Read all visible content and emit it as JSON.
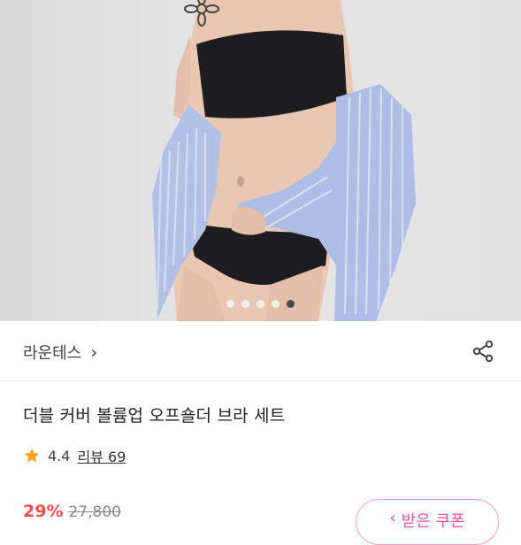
{
  "product": {
    "brand": "라운테스",
    "title": "더블 커버 볼륨업 오프숄더 브라 세트",
    "rating": "4.4",
    "review_label": "리뷰 69",
    "discount": "29%",
    "original_price": "27,800",
    "coupon_label": "받은 쿠폰"
  },
  "gallery": {
    "slide_count": 5,
    "active_index": 4
  },
  "icons": {
    "brand_arrow": "chevron-right-icon",
    "share": "share-icon",
    "rating": "star-icon",
    "coupon": "chevron-left-icon"
  },
  "colors": {
    "discount": "#ff4b4b",
    "star": "#f5a623",
    "coupon_border": "#f3a0c2",
    "coupon_text": "#e8559a"
  }
}
